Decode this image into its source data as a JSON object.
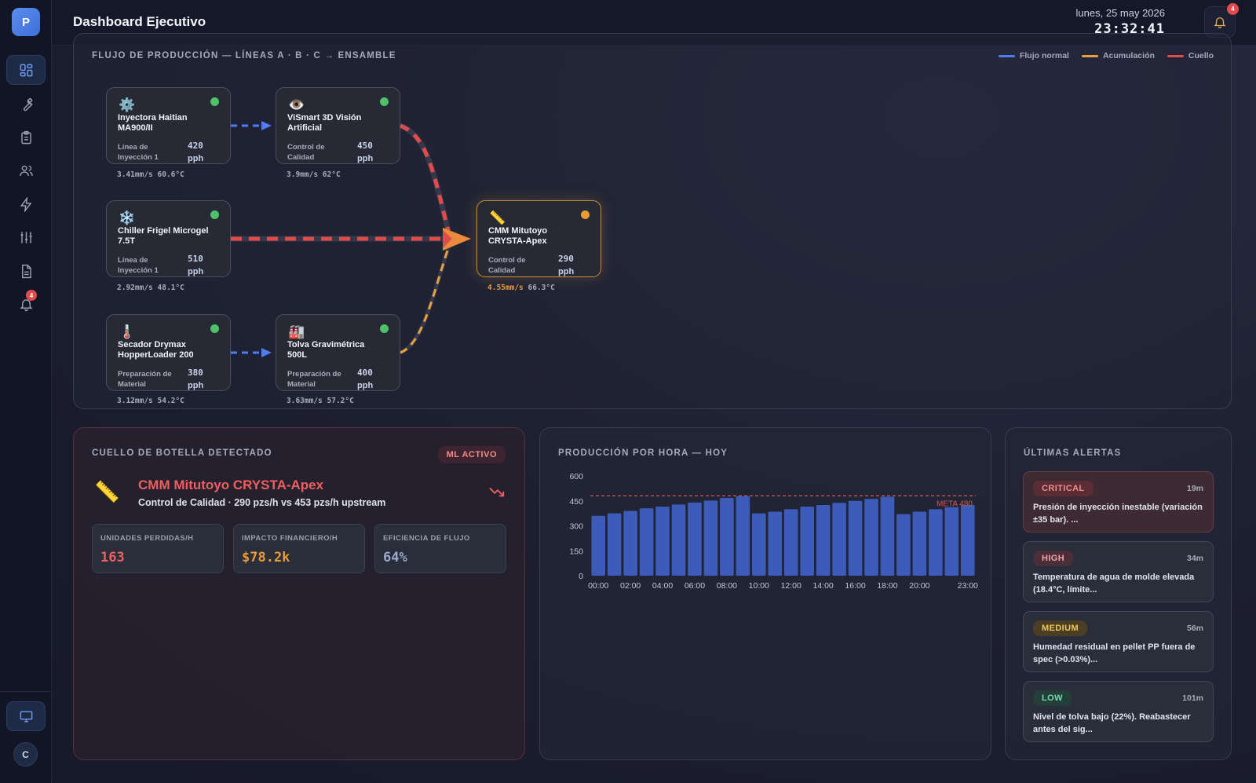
{
  "app": {
    "logo_letter": "P",
    "page_title": "Dashboard Ejecutivo",
    "date": "lunes, 25 may 2026",
    "time": "23:32:41",
    "notification_count": "4",
    "user_initial": "C"
  },
  "sidebar": {
    "items": [
      {
        "icon": "dashboard-icon",
        "active": true
      },
      {
        "icon": "wrench-icon"
      },
      {
        "icon": "clipboard-icon"
      },
      {
        "icon": "users-icon"
      },
      {
        "icon": "lightning-icon"
      },
      {
        "icon": "sliders-icon"
      },
      {
        "icon": "document-icon"
      },
      {
        "icon": "bell-icon",
        "badge": "4"
      }
    ],
    "bottom_item": {
      "icon": "monitor-icon"
    }
  },
  "flow": {
    "title": "FLUJO DE PRODUCCIÓN — LÍNEAS A · B · C → ENSAMBLE",
    "legend": [
      {
        "label": "Flujo normal",
        "color": "#4f7cf0"
      },
      {
        "label": "Acumulación",
        "color": "#e9a040"
      },
      {
        "label": "Cuello",
        "color": "#e24b4b"
      }
    ],
    "nodes": [
      {
        "name": "Inyectora Haitian MA900/II",
        "type": "Línea de Inyección 1",
        "rate": "420",
        "unit": "pph",
        "vibration": "3.41mm/s",
        "temp": "60.6°C",
        "icon": "gear-icon",
        "status_color": "#4cc36a"
      },
      {
        "name": "ViSmart 3D Visión Artificial",
        "type": "Control de Calidad",
        "rate": "450",
        "unit": "pph",
        "vibration": "3.9mm/s",
        "temp": "62°C",
        "icon": "eye-icon",
        "status_color": "#4cc36a"
      },
      {
        "name": "Chiller Frigel Microgel 7.5T",
        "type": "Línea de Inyección 1",
        "rate": "510",
        "unit": "pph",
        "vibration": "2.92mm/s",
        "temp": "48.1°C",
        "icon": "snowflake-icon",
        "status_color": "#4cc36a"
      },
      {
        "name": "CMM Mitutoyo CRYSTA-Apex",
        "type": "Control de Calidad",
        "rate": "290",
        "unit": "pph",
        "vibration": "4.55mm/s",
        "temp": "66.3°C",
        "icon": "ruler-icon",
        "status_color": "#eb9b35"
      },
      {
        "name": "Secador Drymax HopperLoader 200",
        "type": "Preparación de Material",
        "rate": "380",
        "unit": "pph",
        "vibration": "3.12mm/s",
        "temp": "54.2°C",
        "icon": "thermometer-icon",
        "status_color": "#4cc36a"
      },
      {
        "name": "Tolva Gravimétrica 500L",
        "type": "Preparación de Material",
        "rate": "400",
        "unit": "pph",
        "vibration": "3.63mm/s",
        "temp": "57.2°C",
        "icon": "factory-icon",
        "status_color": "#4cc36a"
      }
    ]
  },
  "bottleneck": {
    "title": "CUELLO DE BOTELLA DETECTADO",
    "badge": "ML ACTIVO",
    "machine": "CMM Mitutoyo CRYSTA-Apex",
    "description": "Control de Calidad · 290 pzs/h vs 453 pzs/h upstream",
    "icon": "ruler-icon",
    "trend_icon": "trend-down-icon",
    "stats": [
      {
        "label": "UNIDADES PERDIDAS/H",
        "value": "163",
        "color": "#ef5f5f"
      },
      {
        "label": "IMPACTO FINANCIERO/H",
        "value": "$78.2k",
        "color": "#eb9b35"
      },
      {
        "label": "EFICIENCIA DE FLUJO",
        "value": "64%",
        "color": "#9aa9c9"
      }
    ]
  },
  "production": {
    "title": "PRODUCCIÓN POR HORA — HOY"
  },
  "chart_data": {
    "type": "bar",
    "title": "PRODUCCIÓN POR HORA — HOY",
    "categories": [
      "00:00",
      "01:00",
      "02:00",
      "03:00",
      "04:00",
      "05:00",
      "06:00",
      "07:00",
      "08:00",
      "09:00",
      "10:00",
      "11:00",
      "12:00",
      "13:00",
      "14:00",
      "15:00",
      "16:00",
      "17:00",
      "18:00",
      "19:00",
      "20:00",
      "21:00",
      "22:00",
      "23:00"
    ],
    "tick_labels": [
      "00:00",
      "02:00",
      "04:00",
      "06:00",
      "08:00",
      "10:00",
      "12:00",
      "14:00",
      "16:00",
      "18:00",
      "20:00",
      "23:00"
    ],
    "values": [
      360,
      375,
      390,
      405,
      415,
      428,
      440,
      452,
      468,
      478,
      375,
      385,
      400,
      415,
      425,
      438,
      450,
      462,
      475,
      370,
      385,
      400,
      412,
      425
    ],
    "ylim": [
      0,
      600
    ],
    "yticks": [
      0,
      150,
      300,
      450,
      600
    ],
    "target": {
      "label": "META 480",
      "value": 480
    },
    "bar_color": "#3d5bb8",
    "xlabel": "",
    "ylabel": ""
  },
  "alerts": {
    "title": "ÚLTIMAS ALERTAS",
    "items": [
      {
        "severity": "CRITICAL",
        "time": "19m",
        "message": "Presión de inyección inestable (variación ±35 bar). ...",
        "color": "#f08c8c",
        "bg": "#5a2c34"
      },
      {
        "severity": "HIGH",
        "time": "34m",
        "message": "Temperatura de agua de molde elevada (18.4°C, límite...",
        "color": "#f0a3a3",
        "bg": "#4a2f38"
      },
      {
        "severity": "MEDIUM",
        "time": "56m",
        "message": "Humedad residual en pellet PP fuera de spec (>0.03%)...",
        "color": "#efc45a",
        "bg": "#4a3e24"
      },
      {
        "severity": "LOW",
        "time": "101m",
        "message": "Nivel de tolva bajo (22%). Reabastecer antes del sig...",
        "color": "#6fdcb0",
        "bg": "#243e38"
      }
    ]
  }
}
